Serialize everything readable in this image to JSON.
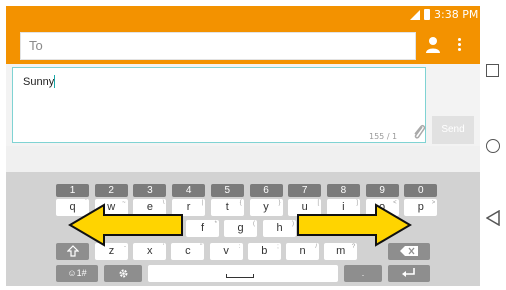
{
  "status_bar": {
    "time": "3:38 PM",
    "icons": [
      "signal-icon",
      "battery-icon"
    ]
  },
  "header": {
    "to_placeholder": "To",
    "icons": [
      "contact-icon",
      "more-vert-icon"
    ]
  },
  "compose": {
    "message": "Sunny",
    "counter": "155 / 1",
    "send_label": "Send",
    "attach_icon": "paperclip-icon"
  },
  "keyboard": {
    "numbers": [
      "1",
      "2",
      "3",
      "4",
      "5",
      "6",
      "7",
      "8",
      "9",
      "0"
    ],
    "row1": [
      {
        "k": "q",
        "s": "`"
      },
      {
        "k": "w",
        "s": "~"
      },
      {
        "k": "e",
        "s": "\\"
      },
      {
        "k": "r",
        "s": "|"
      },
      {
        "k": "t",
        "s": "{"
      },
      {
        "k": "y",
        "s": "}"
      },
      {
        "k": "u",
        "s": "["
      },
      {
        "k": "i",
        "s": "]"
      },
      {
        "k": "o",
        "s": "<"
      },
      {
        "k": "p",
        "s": ">"
      }
    ],
    "row2": [
      {
        "k": "f",
        "s": "*"
      },
      {
        "k": "g",
        "s": "("
      },
      {
        "k": "h",
        "s": ")"
      }
    ],
    "row3": [
      {
        "k": "z",
        "s": "-"
      },
      {
        "k": "x",
        "s": "'"
      },
      {
        "k": "c",
        "s": "\""
      },
      {
        "k": "v",
        "s": ":"
      },
      {
        "k": "b",
        "s": ";"
      },
      {
        "k": "n",
        "s": "/"
      },
      {
        "k": "m",
        "s": "?"
      }
    ],
    "symbols_label": "☺1#",
    "shift_icon": "shift-up-arrow-icon",
    "backspace_icon": "backspace-icon",
    "settings_icon": "gear-icon",
    "enter_icon": "enter-icon",
    "comma_label": ",",
    "period_label": "."
  },
  "overlay": {
    "arrows": [
      "left-arrow-icon",
      "right-arrow-icon"
    ],
    "arrow_color": "#ffd400"
  },
  "nav": {
    "icons": [
      "recent-apps-icon",
      "home-icon",
      "back-icon"
    ]
  },
  "colors": {
    "accent": "#f39200",
    "text_field_border": "#7fd3d3"
  }
}
